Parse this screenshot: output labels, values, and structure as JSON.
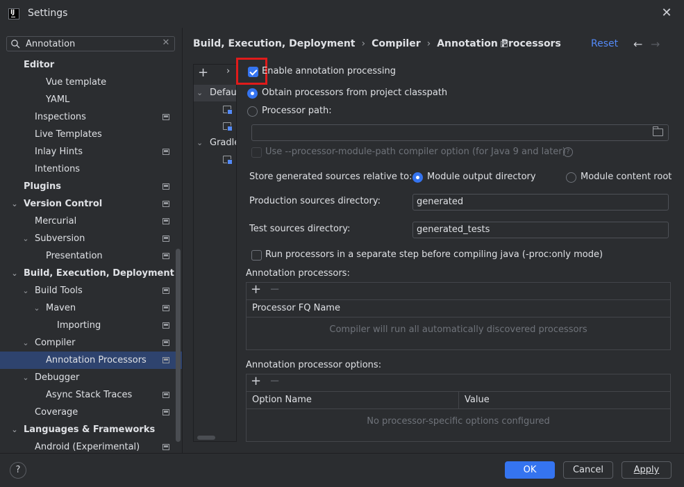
{
  "window": {
    "title": "Settings",
    "close_glyph": "✕"
  },
  "search": {
    "value": "Annotation",
    "clear_glyph": "✕"
  },
  "tree": [
    {
      "label": "Editor",
      "bold": true,
      "chevron": "",
      "indent": 0
    },
    {
      "label": "Vue template",
      "bold": false,
      "chevron": "",
      "indent": 2
    },
    {
      "label": "YAML",
      "bold": false,
      "chevron": "",
      "indent": 2
    },
    {
      "label": "Inspections",
      "bold": false,
      "chevron": "",
      "indent": 1,
      "project": true
    },
    {
      "label": "Live Templates",
      "bold": false,
      "chevron": "",
      "indent": 1
    },
    {
      "label": "Inlay Hints",
      "bold": false,
      "chevron": "",
      "indent": 1,
      "project": true
    },
    {
      "label": "Intentions",
      "bold": false,
      "chevron": "",
      "indent": 1
    },
    {
      "label": "Plugins",
      "bold": true,
      "chevron": "",
      "indent": 0,
      "project": true
    },
    {
      "label": "Version Control",
      "bold": true,
      "chevron": "⌄",
      "indent": 0,
      "project": true
    },
    {
      "label": "Mercurial",
      "bold": false,
      "chevron": "",
      "indent": 1,
      "project": true
    },
    {
      "label": "Subversion",
      "bold": false,
      "chevron": "⌄",
      "indent": 1,
      "project": true
    },
    {
      "label": "Presentation",
      "bold": false,
      "chevron": "",
      "indent": 2,
      "project": true
    },
    {
      "label": "Build, Execution, Deployment",
      "bold": true,
      "chevron": "⌄",
      "indent": 0
    },
    {
      "label": "Build Tools",
      "bold": false,
      "chevron": "⌄",
      "indent": 1,
      "project": true
    },
    {
      "label": "Maven",
      "bold": false,
      "chevron": "⌄",
      "indent": 2,
      "project": true
    },
    {
      "label": "Importing",
      "bold": false,
      "chevron": "",
      "indent": 3,
      "project": true
    },
    {
      "label": "Compiler",
      "bold": false,
      "chevron": "⌄",
      "indent": 1,
      "project": true
    },
    {
      "label": "Annotation Processors",
      "bold": false,
      "chevron": "",
      "indent": 2,
      "project": true,
      "selected": true
    },
    {
      "label": "Debugger",
      "bold": false,
      "chevron": "⌄",
      "indent": 1
    },
    {
      "label": "Async Stack Traces",
      "bold": false,
      "chevron": "",
      "indent": 2,
      "project": true
    },
    {
      "label": "Coverage",
      "bold": false,
      "chevron": "",
      "indent": 1,
      "project": true
    },
    {
      "label": "Languages & Frameworks",
      "bold": true,
      "chevron": "⌄",
      "indent": 0
    },
    {
      "label": "Android (Experimental)",
      "bold": false,
      "chevron": "",
      "indent": 1,
      "project": true
    }
  ],
  "breadcrumb": {
    "part1": "Build, Execution, Deployment",
    "part2": "Compiler",
    "part3": "Annotation Processors",
    "separator": "›"
  },
  "header": {
    "reset": "Reset",
    "back": "←",
    "forward": "→"
  },
  "profiles": {
    "add": "+",
    "more": "›",
    "rows": [
      {
        "label": "Default",
        "chevron": "⌄",
        "type": "group",
        "selected": true
      },
      {
        "label": "",
        "type": "module"
      },
      {
        "label": "",
        "type": "module"
      },
      {
        "label": "Gradle",
        "chevron": "⌄",
        "type": "group"
      },
      {
        "label": "",
        "type": "module"
      }
    ]
  },
  "form": {
    "enable_label": "Enable annotation processing",
    "enable_checked": true,
    "obtain_label": "Obtain processors from project classpath",
    "processor_path_label": "Processor path:",
    "processor_path_value": "",
    "module_path_label": "Use --processor-module-path compiler option (for Java 9 and later)",
    "store_label": "Store generated sources relative to:",
    "module_output_label": "Module output directory",
    "module_content_label": "Module content root",
    "prod_label": "Production sources directory:",
    "prod_value": "generated",
    "test_label": "Test sources directory:",
    "test_value": "generated_tests",
    "run_separate_label": "Run processors in a separate step before compiling java (-proc:only mode)",
    "help_glyph": "?"
  },
  "processors_table": {
    "title": "Annotation processors:",
    "add": "+",
    "remove": "−",
    "columns": [
      "Processor FQ Name"
    ],
    "empty_text": "Compiler will run all automatically discovered processors"
  },
  "options_table": {
    "title": "Annotation processor options:",
    "add": "+",
    "remove": "−",
    "columns": [
      "Option Name",
      "Value"
    ],
    "empty_text": "No processor-specific options configured"
  },
  "footer": {
    "help": "?",
    "ok": "OK",
    "cancel": "Cancel",
    "apply": "Apply"
  },
  "colors": {
    "accent": "#3574f0",
    "link": "#548af7",
    "selection": "#2e436e",
    "highlight": "#e01b1b"
  }
}
